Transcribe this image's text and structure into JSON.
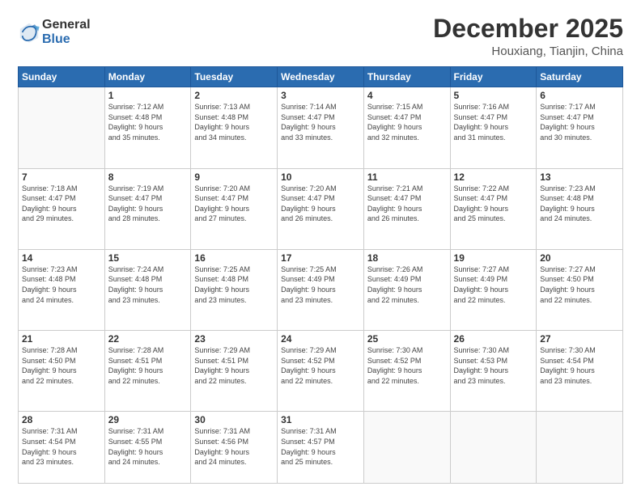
{
  "logo": {
    "general": "General",
    "blue": "Blue"
  },
  "header": {
    "month": "December 2025",
    "location": "Houxiang, Tianjin, China"
  },
  "weekdays": [
    "Sunday",
    "Monday",
    "Tuesday",
    "Wednesday",
    "Thursday",
    "Friday",
    "Saturday"
  ],
  "weeks": [
    [
      {
        "day": "",
        "info": ""
      },
      {
        "day": "1",
        "info": "Sunrise: 7:12 AM\nSunset: 4:48 PM\nDaylight: 9 hours\nand 35 minutes."
      },
      {
        "day": "2",
        "info": "Sunrise: 7:13 AM\nSunset: 4:48 PM\nDaylight: 9 hours\nand 34 minutes."
      },
      {
        "day": "3",
        "info": "Sunrise: 7:14 AM\nSunset: 4:47 PM\nDaylight: 9 hours\nand 33 minutes."
      },
      {
        "day": "4",
        "info": "Sunrise: 7:15 AM\nSunset: 4:47 PM\nDaylight: 9 hours\nand 32 minutes."
      },
      {
        "day": "5",
        "info": "Sunrise: 7:16 AM\nSunset: 4:47 PM\nDaylight: 9 hours\nand 31 minutes."
      },
      {
        "day": "6",
        "info": "Sunrise: 7:17 AM\nSunset: 4:47 PM\nDaylight: 9 hours\nand 30 minutes."
      }
    ],
    [
      {
        "day": "7",
        "info": "Sunrise: 7:18 AM\nSunset: 4:47 PM\nDaylight: 9 hours\nand 29 minutes."
      },
      {
        "day": "8",
        "info": "Sunrise: 7:19 AM\nSunset: 4:47 PM\nDaylight: 9 hours\nand 28 minutes."
      },
      {
        "day": "9",
        "info": "Sunrise: 7:20 AM\nSunset: 4:47 PM\nDaylight: 9 hours\nand 27 minutes."
      },
      {
        "day": "10",
        "info": "Sunrise: 7:20 AM\nSunset: 4:47 PM\nDaylight: 9 hours\nand 26 minutes."
      },
      {
        "day": "11",
        "info": "Sunrise: 7:21 AM\nSunset: 4:47 PM\nDaylight: 9 hours\nand 26 minutes."
      },
      {
        "day": "12",
        "info": "Sunrise: 7:22 AM\nSunset: 4:47 PM\nDaylight: 9 hours\nand 25 minutes."
      },
      {
        "day": "13",
        "info": "Sunrise: 7:23 AM\nSunset: 4:48 PM\nDaylight: 9 hours\nand 24 minutes."
      }
    ],
    [
      {
        "day": "14",
        "info": "Sunrise: 7:23 AM\nSunset: 4:48 PM\nDaylight: 9 hours\nand 24 minutes."
      },
      {
        "day": "15",
        "info": "Sunrise: 7:24 AM\nSunset: 4:48 PM\nDaylight: 9 hours\nand 23 minutes."
      },
      {
        "day": "16",
        "info": "Sunrise: 7:25 AM\nSunset: 4:48 PM\nDaylight: 9 hours\nand 23 minutes."
      },
      {
        "day": "17",
        "info": "Sunrise: 7:25 AM\nSunset: 4:49 PM\nDaylight: 9 hours\nand 23 minutes."
      },
      {
        "day": "18",
        "info": "Sunrise: 7:26 AM\nSunset: 4:49 PM\nDaylight: 9 hours\nand 22 minutes."
      },
      {
        "day": "19",
        "info": "Sunrise: 7:27 AM\nSunset: 4:49 PM\nDaylight: 9 hours\nand 22 minutes."
      },
      {
        "day": "20",
        "info": "Sunrise: 7:27 AM\nSunset: 4:50 PM\nDaylight: 9 hours\nand 22 minutes."
      }
    ],
    [
      {
        "day": "21",
        "info": "Sunrise: 7:28 AM\nSunset: 4:50 PM\nDaylight: 9 hours\nand 22 minutes."
      },
      {
        "day": "22",
        "info": "Sunrise: 7:28 AM\nSunset: 4:51 PM\nDaylight: 9 hours\nand 22 minutes."
      },
      {
        "day": "23",
        "info": "Sunrise: 7:29 AM\nSunset: 4:51 PM\nDaylight: 9 hours\nand 22 minutes."
      },
      {
        "day": "24",
        "info": "Sunrise: 7:29 AM\nSunset: 4:52 PM\nDaylight: 9 hours\nand 22 minutes."
      },
      {
        "day": "25",
        "info": "Sunrise: 7:30 AM\nSunset: 4:52 PM\nDaylight: 9 hours\nand 22 minutes."
      },
      {
        "day": "26",
        "info": "Sunrise: 7:30 AM\nSunset: 4:53 PM\nDaylight: 9 hours\nand 23 minutes."
      },
      {
        "day": "27",
        "info": "Sunrise: 7:30 AM\nSunset: 4:54 PM\nDaylight: 9 hours\nand 23 minutes."
      }
    ],
    [
      {
        "day": "28",
        "info": "Sunrise: 7:31 AM\nSunset: 4:54 PM\nDaylight: 9 hours\nand 23 minutes."
      },
      {
        "day": "29",
        "info": "Sunrise: 7:31 AM\nSunset: 4:55 PM\nDaylight: 9 hours\nand 24 minutes."
      },
      {
        "day": "30",
        "info": "Sunrise: 7:31 AM\nSunset: 4:56 PM\nDaylight: 9 hours\nand 24 minutes."
      },
      {
        "day": "31",
        "info": "Sunrise: 7:31 AM\nSunset: 4:57 PM\nDaylight: 9 hours\nand 25 minutes."
      },
      {
        "day": "",
        "info": ""
      },
      {
        "day": "",
        "info": ""
      },
      {
        "day": "",
        "info": ""
      }
    ]
  ]
}
